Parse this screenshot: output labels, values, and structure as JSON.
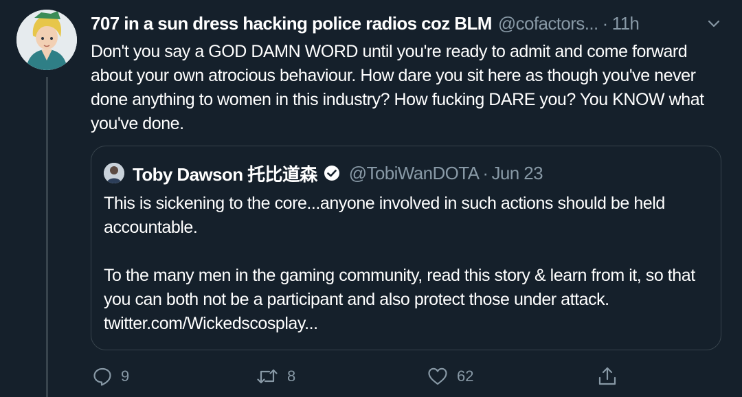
{
  "tweet": {
    "display_name": "707 in a sun dress hacking police radios coz BLM",
    "handle": "@cofactors...",
    "separator": "·",
    "time": "11h",
    "text": "Don't you say a GOD DAMN WORD until you're ready to admit and come forward about your own atrocious behaviour. How dare you sit here as though you've never done anything to women in this industry? How fucking DARE you? You KNOW what you've done."
  },
  "quote": {
    "display_name": "Toby Dawson 托比道森",
    "handle": "@TobiWanDOTA",
    "separator": "·",
    "date": "Jun 23",
    "paragraph_1": "This is sickening to the core...anyone involved in such actions should be held accountable.",
    "paragraph_2": "To the many men in the gaming community,  read this story & learn from it, so that you can both not be a participant and also protect those under attack. twitter.com/Wickedscosplay..."
  },
  "actions": {
    "replies": "9",
    "retweets": "8",
    "likes": "62"
  },
  "icons": {
    "avatar": "anime-avatar-icon",
    "caret": "chevron-down-icon",
    "verified": "verified-badge-icon",
    "reply": "reply-icon",
    "retweet": "retweet-icon",
    "like": "heart-icon",
    "share": "share-icon"
  },
  "colors": {
    "background": "#15202b",
    "text": "#ffffff",
    "secondary_text": "#8899a6",
    "border": "#38444d"
  }
}
